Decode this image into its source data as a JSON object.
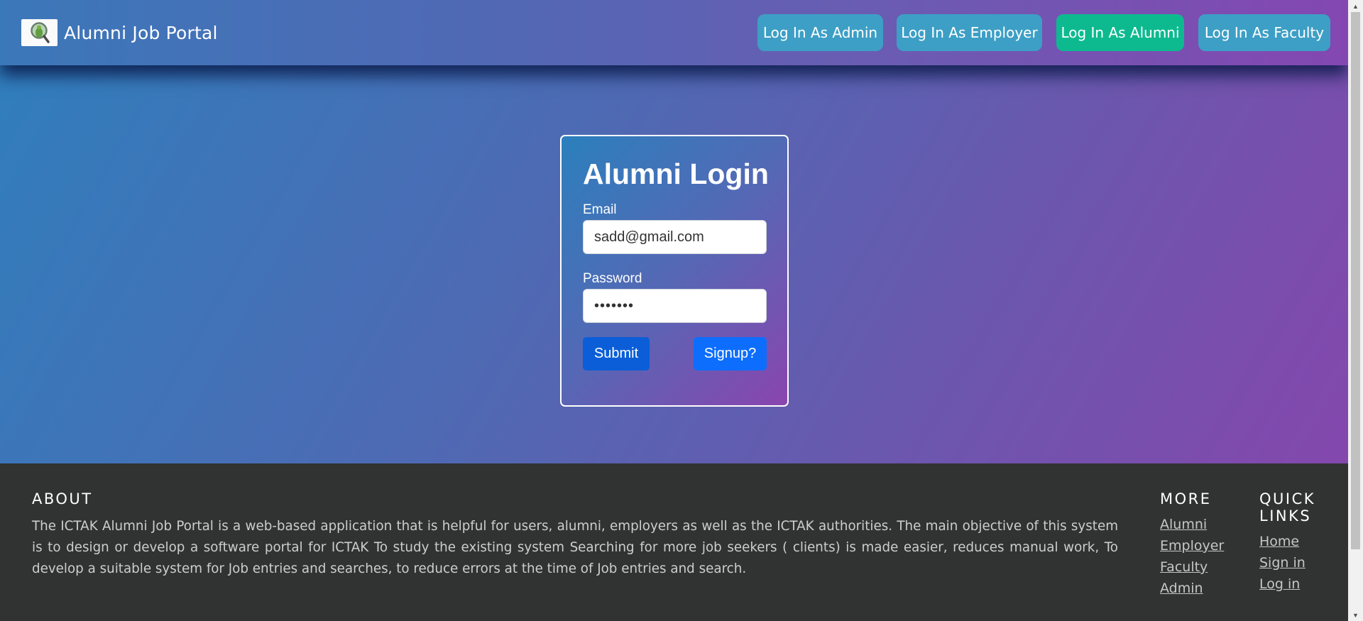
{
  "navbar": {
    "brand_title": "Alumni Job Portal",
    "buttons": [
      {
        "label": "Log In As Admin",
        "active": false
      },
      {
        "label": "Log In As Employer",
        "active": false
      },
      {
        "label": "Log In As Alumni",
        "active": true
      },
      {
        "label": "Log In As Faculty",
        "active": false
      }
    ]
  },
  "login": {
    "title": "Alumni Login",
    "email_label": "Email",
    "email_value": "sadd@gmail.com",
    "password_label": "Password",
    "password_value": "•••••••",
    "submit_label": "Submit",
    "signup_label": "Signup?"
  },
  "footer": {
    "about_heading": "ABOUT",
    "about_text": "The ICTAK Alumni Job Portal is a web-based application that is helpful for users, alumni, employers as well as the ICTAK authorities. The main objective of this system is to design or develop a software portal for ICTAK To study the existing system Searching for more job seekers ( clients) is made easier, reduces manual work, To develop a suitable system for Job entries and searches, to reduce errors at the time of Job entries and search.",
    "more_heading": "MORE",
    "more_links": [
      "Alumni",
      "Employer",
      "Faculty",
      "Admin"
    ],
    "quick_heading": "QUICK LINKS",
    "quick_links": [
      "Home",
      "Sign in",
      "Log in"
    ]
  },
  "colors": {
    "nav_button": "#3d9fc5",
    "nav_button_active": "#0dba8f",
    "submit_button": "#0b5ed7",
    "signup_button": "#0d6efd",
    "footer_bg": "#313332"
  },
  "icons": {
    "brand_logo": "magnifier-person-icon",
    "scroll_up": "triangle-up-icon",
    "scroll_down": "triangle-down-icon"
  }
}
